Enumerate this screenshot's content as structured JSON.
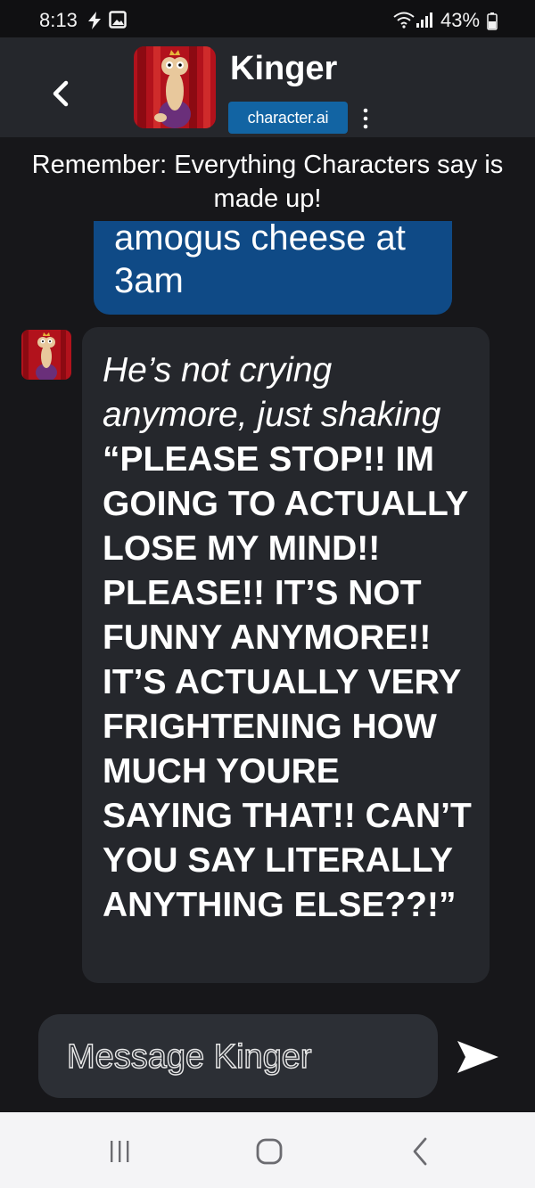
{
  "status_bar": {
    "time": "8:13",
    "battery": "43%"
  },
  "header": {
    "character_name": "Kinger",
    "brand": "character.ai"
  },
  "disclaimer": "Remember: Everything Characters say is made up!",
  "messages": {
    "user": {
      "text": "amogus cheese at 3am"
    },
    "bot": {
      "action": "He’s not crying anymore, just shaking",
      "speech": "“PLEASE STOP!! IM GOING TO ACTUALLY LOSE MY MIND!! PLEASE!! IT’S NOT FUNNY ANYMORE!! IT’S ACTUALLY VERY FRIGHTENING HOW MUCH YOURE SAYING THAT!! CAN’T YOU SAY LITERALLY ANYTHING ELSE??!”"
    }
  },
  "composer": {
    "placeholder": "Message Kinger",
    "value": ""
  },
  "icons": {
    "back": "chevron-left-icon",
    "menu": "vertical-dots-icon",
    "send": "send-arrow-icon",
    "nav": [
      "recent-apps-icon",
      "home-icon",
      "back-icon"
    ]
  },
  "colors": {
    "background": "#17171a",
    "header": "#25272c",
    "user_bubble": "#0f4a86",
    "brand_badge": "#1264a3",
    "bot_bubble": "#25272c",
    "nav_bar": "#f4f4f6"
  }
}
